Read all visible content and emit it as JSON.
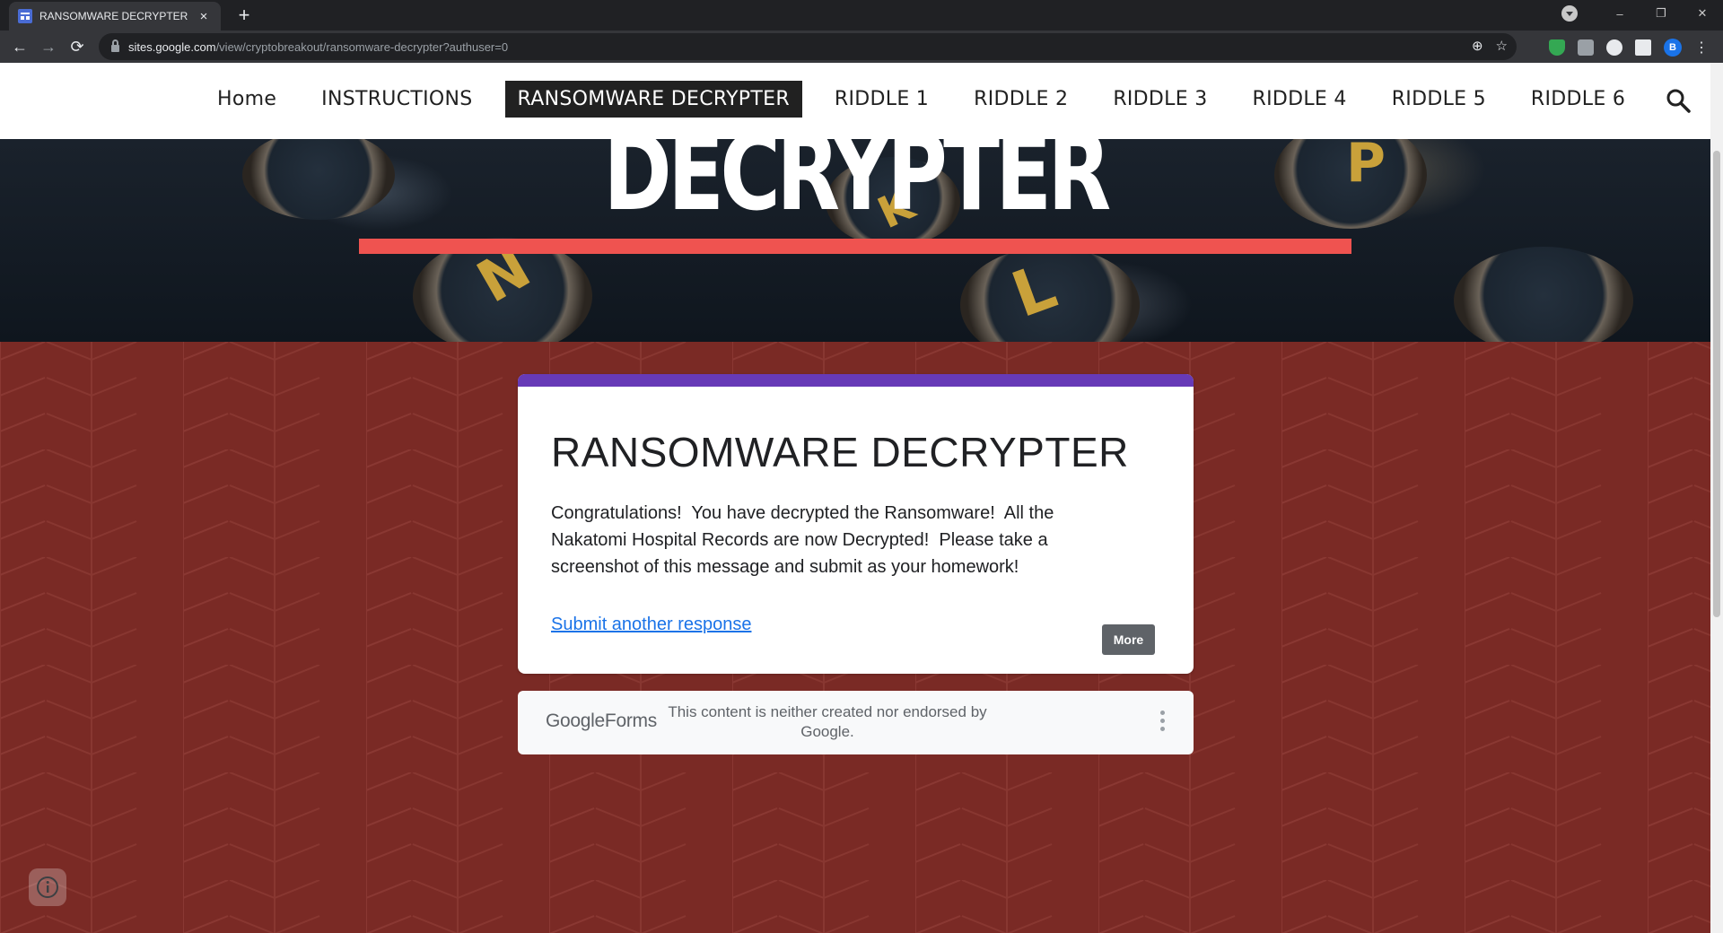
{
  "browser": {
    "tab": {
      "title": "RANSOMWARE DECRYPTER",
      "close_icon": "×"
    },
    "new_tab_icon": "+",
    "window_controls": {
      "minimize": "–",
      "restore": "❐",
      "close": "✕"
    },
    "nav": {
      "back": "←",
      "forward": "→",
      "reload": "⟳"
    },
    "url": {
      "host": "sites.google.com",
      "path": "/view/cryptobreakout/ransomware-decrypter?authuser=0"
    },
    "omnibox_icons": {
      "zoom": "⊕",
      "bookmark": "☆"
    },
    "profile_initial": "B",
    "menu_icon": "⋮"
  },
  "site": {
    "nav_items": [
      "Home",
      "INSTRUCTIONS",
      "RANSOMWARE DECRYPTER",
      "RIDDLE 1",
      "RIDDLE 2",
      "RIDDLE 3",
      "RIDDLE 4",
      "RIDDLE 5",
      "RIDDLE 6"
    ],
    "active_nav": "RANSOMWARE DECRYPTER",
    "banner_title": "DECRYPTER",
    "banner_keys": [
      "P",
      "L",
      "N",
      "K"
    ]
  },
  "form": {
    "title": "RANSOMWARE DECRYPTER",
    "message": "Congratulations!  You have decrypted the Ransomware!  All the Nakatomi Hospital Records are now Decrypted!  Please take a screenshot of this message and submit as your homework!",
    "submit_another": "Submit another response",
    "more_button": "More",
    "accent_color": "#673ab7"
  },
  "footer": {
    "logo_google": "Google",
    "logo_forms": "Forms",
    "disclaimer": "This content is neither created nor endorsed by Google."
  },
  "colors": {
    "page_background": "#7a2a25",
    "banner_rule": "#ef5350",
    "link": "#1a73e8"
  }
}
